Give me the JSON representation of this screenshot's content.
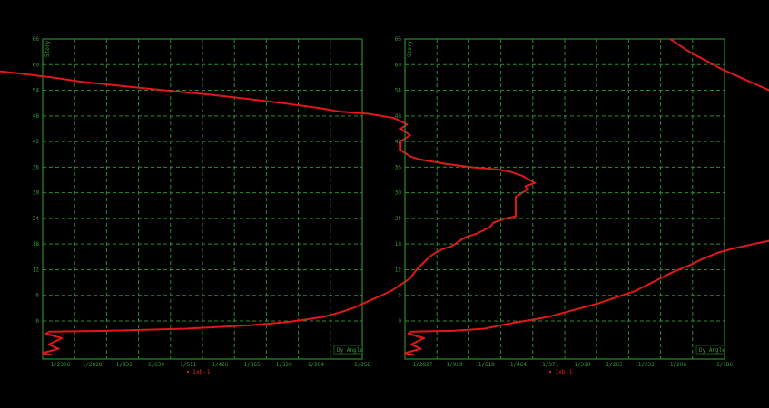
{
  "chart_data": [
    {
      "type": "line",
      "ylabel": "Story",
      "xlabel": "Dy Angle",
      "yticks": [
        "0",
        "6",
        "12",
        "18",
        "24",
        "30",
        "36",
        "42",
        "48",
        "54",
        "60",
        "66"
      ],
      "xticks": [
        "1/2306",
        "1/2028",
        "1/832",
        "1/630",
        "1/511",
        "1/426",
        "1/365",
        "1/320",
        "1/284",
        "1/256"
      ],
      "ylim": [
        -8,
        66
      ],
      "grid": true,
      "legend": "bottom-center",
      "series": [
        {
          "name": "1xb-1",
          "color": "#e01818",
          "points": [
            [
              0.3,
              -8
            ],
            [
              0.0,
              -7.5
            ],
            [
              0.5,
              -6.5
            ],
            [
              0.2,
              -5.5
            ],
            [
              0.6,
              -4
            ],
            [
              0.1,
              -3
            ],
            [
              0.2,
              -2.5
            ],
            [
              2.0,
              -2.3
            ],
            [
              4.5,
              -1.8
            ],
            [
              6.5,
              -1
            ],
            [
              7.6,
              -0.3
            ],
            [
              8.2,
              0.3
            ],
            [
              8.8,
              1
            ],
            [
              9.3,
              2
            ],
            [
              9.7,
              3
            ],
            [
              10.0,
              4
            ],
            [
              10.3,
              5
            ],
            [
              10.6,
              6
            ],
            [
              10.9,
              7
            ],
            [
              11.2,
              8.5
            ],
            [
              11.5,
              10
            ],
            [
              11.7,
              12
            ],
            [
              11.9,
              13.5
            ],
            [
              12.1,
              15
            ],
            [
              12.3,
              16
            ],
            [
              12.5,
              16.8
            ],
            [
              12.8,
              17.5
            ],
            [
              13.0,
              18.5
            ],
            [
              13.2,
              19.5
            ],
            [
              13.6,
              20.5
            ],
            [
              14.0,
              22
            ],
            [
              14.1,
              23
            ],
            [
              14.5,
              24
            ],
            [
              14.8,
              24.5
            ],
            [
              14.8,
              26
            ],
            [
              14.8,
              28
            ],
            [
              14.8,
              29
            ],
            [
              15.0,
              30
            ],
            [
              15.2,
              30.8
            ],
            [
              15.1,
              31.5
            ],
            [
              15.4,
              32.3
            ],
            [
              15.0,
              34
            ],
            [
              14.6,
              35
            ],
            [
              14.2,
              35.5
            ],
            [
              13.4,
              36
            ],
            [
              12.6,
              36.8
            ],
            [
              11.8,
              37.8
            ],
            [
              11.5,
              38.5
            ],
            [
              11.2,
              40
            ],
            [
              11.2,
              42
            ],
            [
              11.5,
              43.5
            ],
            [
              11.2,
              45
            ],
            [
              11.4,
              46
            ],
            [
              11.0,
              47.5
            ],
            [
              10.2,
              48.5
            ],
            [
              9.3,
              49
            ],
            [
              8.7,
              49.8
            ],
            [
              7.5,
              51
            ],
            [
              6.4,
              52
            ],
            [
              5.2,
              53
            ],
            [
              3.8,
              54
            ],
            [
              2.5,
              55
            ],
            [
              1.2,
              56
            ],
            [
              0.3,
              57
            ],
            [
              -0.8,
              58
            ],
            [
              -2.0,
              59
            ],
            [
              -3.0,
              59.5
            ],
            [
              -3.8,
              60
            ],
            [
              -4.3,
              61
            ],
            [
              -4.6,
              62
            ],
            [
              -4.7,
              63.5
            ],
            [
              -4.9,
              65
            ],
            [
              -5.1,
              66
            ]
          ]
        }
      ]
    },
    {
      "type": "line",
      "ylabel": "Story",
      "xlabel": "Dy Angle",
      "yticks": [
        "0",
        "6",
        "12",
        "18",
        "24",
        "30",
        "36",
        "42",
        "48",
        "54",
        "60",
        "66"
      ],
      "xticks": [
        "1/2827",
        "1/929",
        "1/618",
        "1/464",
        "1/371",
        "1/310",
        "1/265",
        "1/232",
        "1/206",
        "1/186"
      ],
      "ylim": [
        -8,
        66
      ],
      "grid": true,
      "legend": "bottom-center",
      "series": [
        {
          "name": "1xb-1",
          "color": "#e01818",
          "points": [
            [
              0.3,
              -8
            ],
            [
              0.0,
              -7.5
            ],
            [
              0.5,
              -6.5
            ],
            [
              0.2,
              -5.5
            ],
            [
              0.6,
              -4
            ],
            [
              0.1,
              -3
            ],
            [
              0.2,
              -2.5
            ],
            [
              1.5,
              -2.3
            ],
            [
              2.5,
              -1.8
            ],
            [
              3.0,
              -1
            ],
            [
              3.5,
              -0.3
            ],
            [
              4.0,
              0.3
            ],
            [
              4.5,
              1
            ],
            [
              5.0,
              2
            ],
            [
              5.5,
              3
            ],
            [
              6.0,
              4
            ],
            [
              6.4,
              5
            ],
            [
              6.8,
              6
            ],
            [
              7.2,
              7
            ],
            [
              7.6,
              8.5
            ],
            [
              8.0,
              10
            ],
            [
              8.4,
              11.5
            ],
            [
              8.9,
              13
            ],
            [
              9.3,
              14.5
            ],
            [
              9.8,
              16
            ],
            [
              10.3,
              17
            ],
            [
              10.9,
              18
            ],
            [
              11.5,
              18.9
            ],
            [
              12.0,
              19.8
            ],
            [
              12.5,
              20.8
            ],
            [
              12.9,
              22
            ],
            [
              13.3,
              23
            ],
            [
              13.6,
              24
            ],
            [
              13.9,
              25
            ],
            [
              14.1,
              26
            ],
            [
              14.3,
              27
            ],
            [
              14.45,
              28
            ],
            [
              14.6,
              29
            ],
            [
              14.75,
              30
            ],
            [
              14.85,
              31
            ],
            [
              14.95,
              32
            ],
            [
              15.05,
              33
            ],
            [
              15.12,
              34
            ],
            [
              15.15,
              35
            ],
            [
              15.15,
              36
            ],
            [
              15.12,
              37
            ],
            [
              15.05,
              38
            ],
            [
              15.0,
              39
            ],
            [
              14.9,
              40
            ],
            [
              14.8,
              41
            ],
            [
              14.65,
              42
            ],
            [
              14.5,
              43
            ],
            [
              14.35,
              44
            ],
            [
              14.2,
              45
            ],
            [
              14.0,
              46
            ],
            [
              13.75,
              47
            ],
            [
              13.5,
              48
            ],
            [
              13.15,
              49
            ],
            [
              12.8,
              50
            ],
            [
              12.45,
              51
            ],
            [
              12.1,
              52
            ],
            [
              11.75,
              53
            ],
            [
              11.4,
              54
            ],
            [
              11.1,
              55
            ],
            [
              10.8,
              56
            ],
            [
              10.5,
              57
            ],
            [
              10.2,
              58
            ],
            [
              9.9,
              59
            ],
            [
              9.65,
              60
            ],
            [
              9.4,
              61
            ],
            [
              9.15,
              62
            ],
            [
              8.9,
              63
            ],
            [
              8.7,
              64
            ],
            [
              8.5,
              65
            ],
            [
              8.3,
              66
            ]
          ]
        }
      ]
    }
  ]
}
